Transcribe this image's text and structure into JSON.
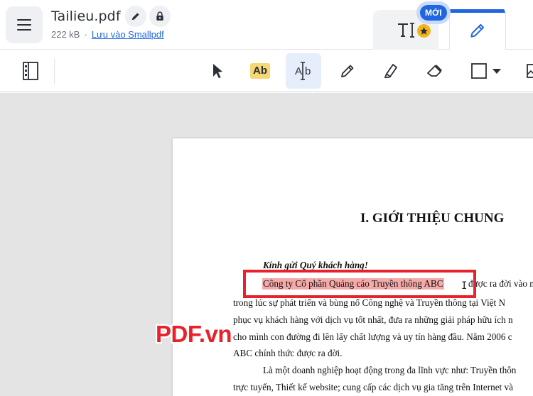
{
  "header": {
    "file_name": "Tailieu.pdf",
    "file_size": "222 kB",
    "meta_separator": "·",
    "save_link": "Lưu vào Smallpdf",
    "new_badge": "MỚI"
  },
  "colors": {
    "accent": "#1f66e0",
    "highlight": "#f5a9a9",
    "annotation_red": "#e8212a",
    "premium_star": "#f1b51c"
  },
  "toolbar": {
    "tools": [
      {
        "icon": "thumbnails-icon"
      },
      {
        "icon": "cursor-arrow-icon"
      },
      {
        "icon": "highlight-text-icon",
        "label": "Ab"
      },
      {
        "icon": "text-select-icon",
        "label": "Ab",
        "active": true
      },
      {
        "icon": "pencil-icon"
      },
      {
        "icon": "marker-icon"
      },
      {
        "icon": "eraser-icon"
      },
      {
        "icon": "shape-rectangle-icon"
      }
    ]
  },
  "document": {
    "heading": "I. GIỚI THIỆU CHUNG",
    "greeting": "Kính gửi Quý khách hàng!",
    "highlighted_text": "Công ty Cổ phần Quảng cáo Truyền thông ABC",
    "line1_rest": "được ra đời vào n",
    "line2": "trong lúc sự phát triển và bùng nổ Công nghệ và Truyền thông tại Việt N",
    "line3": "phục vụ khách hàng với dịch vụ tốt nhất, đưa ra những giải pháp hữu ích n",
    "line4": "cho mình con đường đi lên lấy chất lượng và uy tín hàng đầu. Năm 2006 c",
    "line5": "ABC chính thức được ra đời.",
    "line6": "Là một doanh nghiệp hoạt động trong đa lĩnh vực như: Truyền thôn",
    "line7": "trực tuyến, Thiết kế website; cung cấp các dịch vụ gia tăng trên Internet và"
  },
  "watermark": "PDF.vn"
}
